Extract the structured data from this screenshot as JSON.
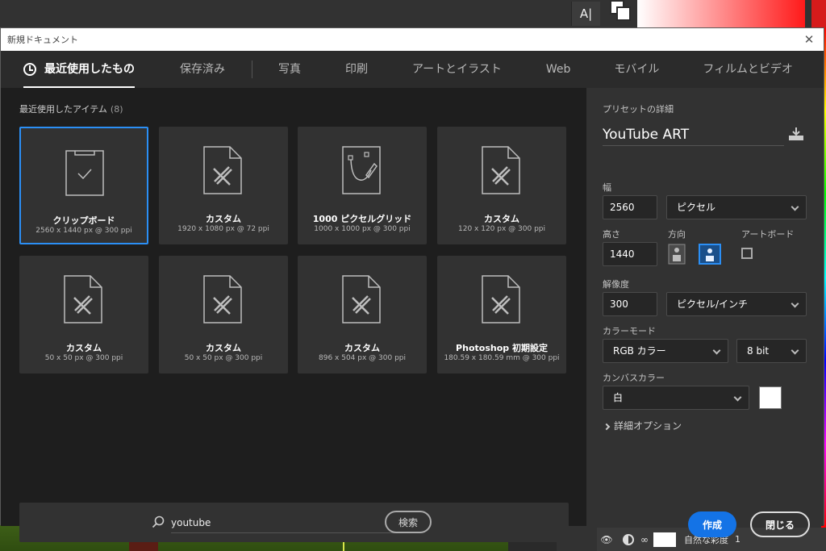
{
  "background": {
    "tool_label": "A|",
    "layer": {
      "name": "自然な彩度",
      "number": "1"
    }
  },
  "dialog": {
    "title": "新規ドキュメント",
    "close_glyph": "✕"
  },
  "tabs": [
    {
      "label": "最近使用したもの",
      "active": true
    },
    {
      "label": "保存済み"
    },
    {
      "label": "写真"
    },
    {
      "label": "印刷"
    },
    {
      "label": "アートとイラスト"
    },
    {
      "label": "Web"
    },
    {
      "label": "モバイル"
    },
    {
      "label": "フィルムとビデオ"
    }
  ],
  "recent": {
    "heading": "最近使用したアイテム",
    "count": "(8)",
    "items": [
      {
        "name": "クリップボード",
        "dims": "2560 x 1440 px @ 300 ppi",
        "icon": "clipboard-icon",
        "selected": true
      },
      {
        "name": "カスタム",
        "dims": "1920 x 1080 px @ 72 ppi",
        "icon": "custom-document-icon"
      },
      {
        "name": "1000 ピクセルグリッド",
        "dims": "1000 x 1000 px @ 300 ppi",
        "icon": "pen-document-icon"
      },
      {
        "name": "カスタム",
        "dims": "120 x 120 px @ 300 ppi",
        "icon": "custom-document-icon"
      },
      {
        "name": "カスタム",
        "dims": "50 x 50 px @ 300 ppi",
        "icon": "custom-document-icon"
      },
      {
        "name": "カスタム",
        "dims": "50 x 50 px @ 300 ppi",
        "icon": "custom-document-icon"
      },
      {
        "name": "カスタム",
        "dims": "896 x 504 px @ 300 ppi",
        "icon": "custom-document-icon"
      },
      {
        "name": "Photoshop 初期設定",
        "dims": "180.59 x 180.59 mm @ 300 ppi",
        "icon": "custom-document-icon"
      }
    ]
  },
  "search": {
    "value": "youtube",
    "button_label": "検索"
  },
  "preset": {
    "heading": "プリセットの詳細",
    "name": "YouTube ART",
    "width_label": "幅",
    "width": "2560",
    "width_unit": "ピクセル",
    "height_label": "高さ",
    "height": "1440",
    "orientation_label": "方向",
    "orientation": "landscape",
    "artboard_label": "アートボード",
    "artboard_checked": false,
    "resolution_label": "解像度",
    "resolution": "300",
    "resolution_unit": "ピクセル/インチ",
    "color_mode_label": "カラーモード",
    "color_mode": "RGB カラー",
    "bit_depth": "8 bit",
    "canvas_color_label": "カンバスカラー",
    "canvas_color": "白",
    "canvas_swatch": "#ffffff",
    "advanced_label": "詳細オプション",
    "create_label": "作成",
    "close_label": "閉じる"
  },
  "colors": {
    "accent": "#1473e6",
    "selected_border": "#2b8ff5",
    "dialog_bg": "#1e1e1e",
    "panel_bg": "#323232"
  }
}
